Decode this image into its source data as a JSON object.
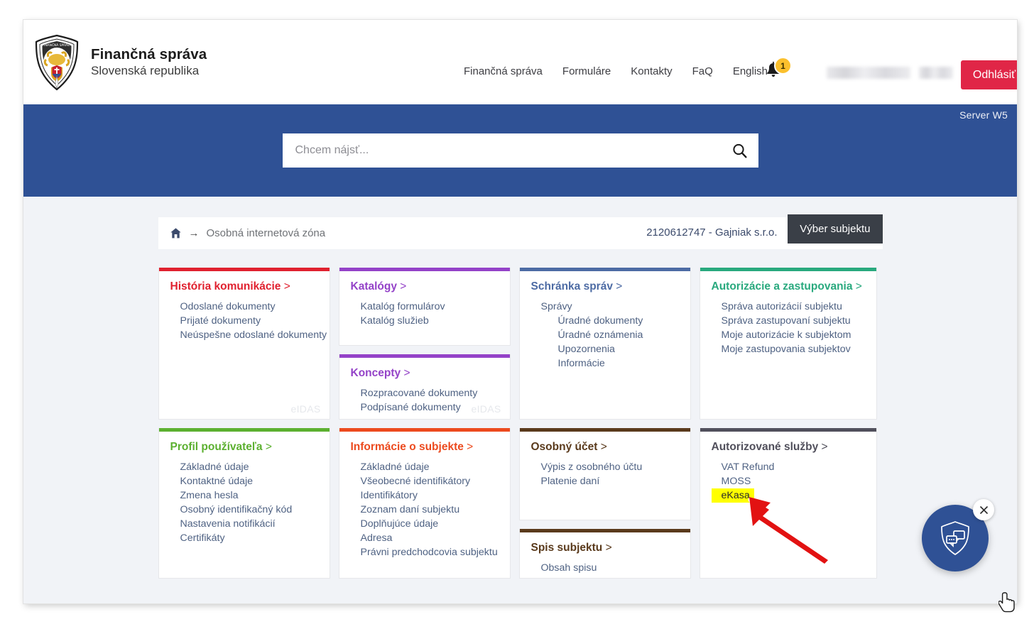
{
  "header": {
    "brand_title": "Finančná správa",
    "brand_subtitle": "Slovenská republika",
    "logo_icon": "coat-of-arms-shield-icon",
    "nav": [
      {
        "label": "Finančná správa"
      },
      {
        "label": "Formuláre"
      },
      {
        "label": "Kontakty"
      },
      {
        "label": "FaQ"
      },
      {
        "label": "English"
      }
    ],
    "bell_icon": "notification-bell-icon",
    "bell_count": "1",
    "user_name_masked": "",
    "logout_label": "Odhlásiť",
    "server_tag": "Server W5"
  },
  "search": {
    "placeholder": "Chcem nájsť...",
    "value": "",
    "icon": "search-icon"
  },
  "breadcrumb": {
    "home_icon": "home-icon",
    "arrow": "→",
    "current": "Osobná internetová zóna",
    "subject": "2120612747 - Gajniak s.r.o.",
    "select_subject_label": "Výber subjektu"
  },
  "cards": [
    {
      "id": "historia-komunikacie",
      "title": "História komunikácie",
      "chevron": ">",
      "accent": "#e0212f",
      "watermark": "eIDAS",
      "links": [
        {
          "label": "Odoslané dokumenty",
          "level": 0
        },
        {
          "label": "Prijaté dokumenty",
          "level": 0
        },
        {
          "label": "Neúspešne odoslané dokumenty",
          "level": 0
        }
      ]
    },
    {
      "id": "katalogy",
      "title": "Katalógy",
      "chevron": ">",
      "accent": "#9442c8",
      "links": [
        {
          "label": "Katalóg formulárov",
          "level": 0
        },
        {
          "label": "Katalóg služieb",
          "level": 0
        }
      ]
    },
    {
      "id": "koncepty",
      "title": "Koncepty",
      "chevron": ">",
      "accent": "#9442c8",
      "watermark": "eIDAS",
      "links": [
        {
          "label": "Rozpracované dokumenty",
          "level": 0
        },
        {
          "label": "Podpísané dokumenty",
          "level": 0
        }
      ]
    },
    {
      "id": "schranka-sprav",
      "title": "Schránka správ",
      "chevron": ">",
      "accent": "#4d6ba4",
      "links": [
        {
          "label": "Správy",
          "level": 0
        },
        {
          "label": "Úradné dokumenty",
          "level": 1
        },
        {
          "label": "Úradné oznámenia",
          "level": 1
        },
        {
          "label": "Upozornenia",
          "level": 1
        },
        {
          "label": "Informácie",
          "level": 1
        }
      ]
    },
    {
      "id": "autorizacie-a-zastupovania",
      "title": "Autorizácie a zastupovania",
      "chevron": ">",
      "accent": "#29a97e",
      "links": [
        {
          "label": "Správa autorizácií subjektu",
          "level": 0
        },
        {
          "label": "Správa zastupovaní subjektu",
          "level": 0
        },
        {
          "label": "Moje autorizácie k subjektom",
          "level": 0
        },
        {
          "label": "Moje zastupovania subjektov",
          "level": 0
        }
      ]
    },
    {
      "id": "profil-pouzivatela",
      "title": "Profil používateľa",
      "chevron": ">",
      "accent": "#5cb030",
      "links": [
        {
          "label": "Základné údaje",
          "level": 0
        },
        {
          "label": "Kontaktné údaje",
          "level": 0
        },
        {
          "label": "Zmena hesla",
          "level": 0
        },
        {
          "label": "Osobný identifikačný kód",
          "level": 0
        },
        {
          "label": "Nastavenia notifikácií",
          "level": 0
        },
        {
          "label": "Certifikáty",
          "level": 0
        }
      ]
    },
    {
      "id": "informacie-o-subjekte",
      "title": "Informácie o subjekte",
      "chevron": ">",
      "accent": "#ec4a1e",
      "links": [
        {
          "label": "Základné údaje",
          "level": 0
        },
        {
          "label": "Všeobecné identifikátory",
          "level": 0
        },
        {
          "label": "Identifikátory",
          "level": 0
        },
        {
          "label": "Zoznam daní subjektu",
          "level": 0
        },
        {
          "label": "Doplňujúce údaje",
          "level": 0
        },
        {
          "label": "Adresa",
          "level": 0
        },
        {
          "label": "Právni predchodcovia subjektu",
          "level": 0
        }
      ]
    },
    {
      "id": "osobny-ucet",
      "title": "Osobný účet",
      "chevron": ">",
      "accent": "#5a3a1c",
      "links": [
        {
          "label": "Výpis z osobného účtu",
          "level": 0
        },
        {
          "label": "Platenie daní",
          "level": 0
        }
      ]
    },
    {
      "id": "spis-subjektu",
      "title": "Spis subjektu",
      "chevron": ">",
      "accent": "#5a3a1c",
      "links": [
        {
          "label": "Obsah spisu",
          "level": 0
        }
      ]
    },
    {
      "id": "autorizovane-sluzby",
      "title": "Autorizované služby",
      "chevron": ">",
      "accent": "#51505c",
      "links": [
        {
          "label": "VAT Refund",
          "level": 0
        },
        {
          "label": "MOSS",
          "level": 0
        },
        {
          "label": "eKasa",
          "level": 0,
          "highlight": true
        }
      ]
    }
  ],
  "chat_widget": {
    "icon": "shield-chat-icon",
    "close_icon": "close-icon",
    "accent": "#2f5195"
  },
  "annotation": {
    "arrow_icon": "red-arrow-icon",
    "arrow_color": "#e21212",
    "points_to": "eKasa"
  },
  "cursor": {
    "icon": "pointer-hand-cursor-icon"
  }
}
